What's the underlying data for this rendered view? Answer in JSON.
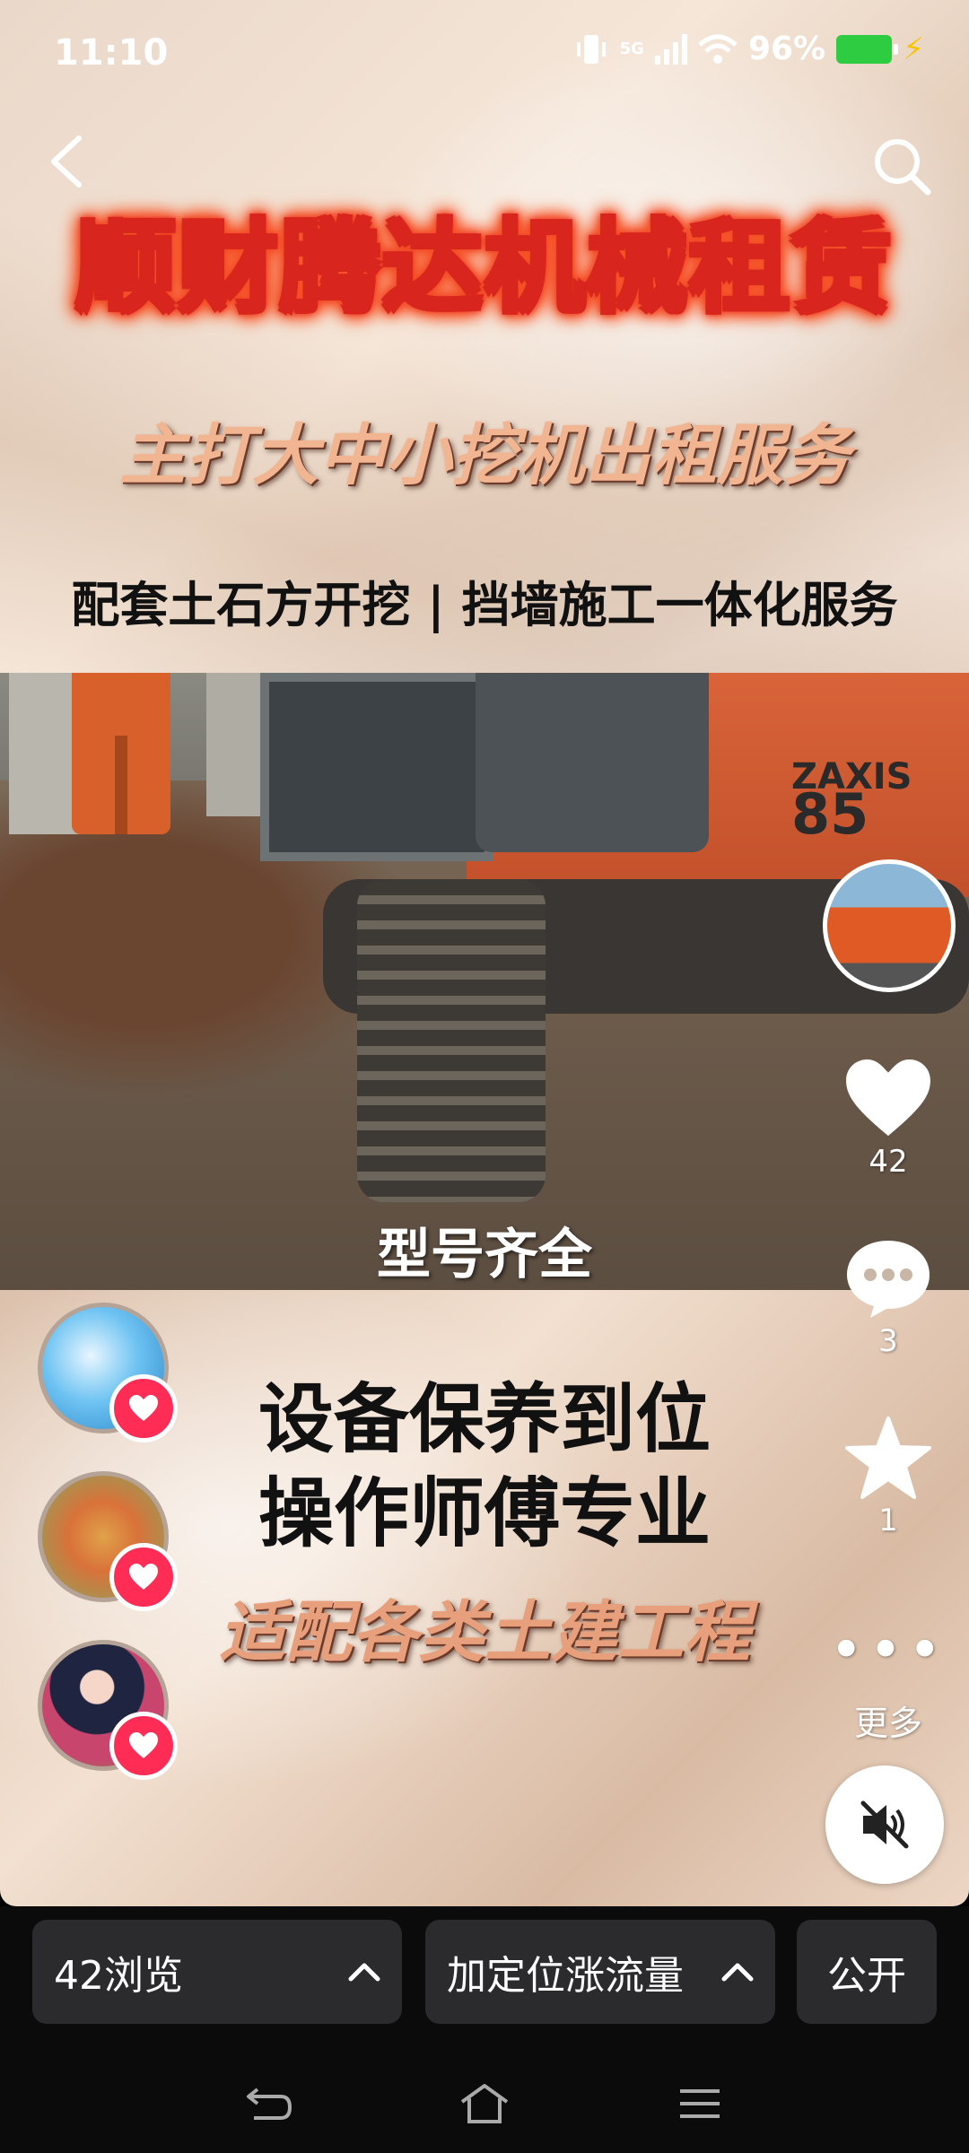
{
  "status_bar": {
    "time": "11:10",
    "network": "5G",
    "battery_percent": "96%",
    "battery_level": 0.96
  },
  "poster": {
    "title": "顺财腾达机械租赁",
    "subtitle1": "主打大中小挖机出租服务",
    "subtitle2": "配套土石方开挖 | 挡墙施工一体化服务",
    "photo_brand_line1": "ZAXIS",
    "photo_brand_line2": "85",
    "photo_caption": "型号齐全",
    "slogan_line1": "设备保养到位",
    "slogan_line2": "操作师傅专业",
    "slogan_line3": "适配各类土建工程"
  },
  "right_rail": {
    "like_count": "42",
    "comment_count": "3",
    "favorite_count": "1",
    "more_label": "更多"
  },
  "bottom_bar": {
    "views_label": "42浏览",
    "promo_label": "加定位涨流量",
    "visibility_label": "公开"
  },
  "colors": {
    "accent_red": "#ff2d55",
    "battery_green": "#2ecc40",
    "title_gold": "#ffd75a"
  },
  "icons": [
    "back-icon",
    "search-icon",
    "heart-icon",
    "comment-icon",
    "star-icon",
    "more-icon",
    "mute-icon",
    "chevron-up-icon",
    "nav-back-icon",
    "nav-home-icon",
    "nav-menu-icon"
  ]
}
